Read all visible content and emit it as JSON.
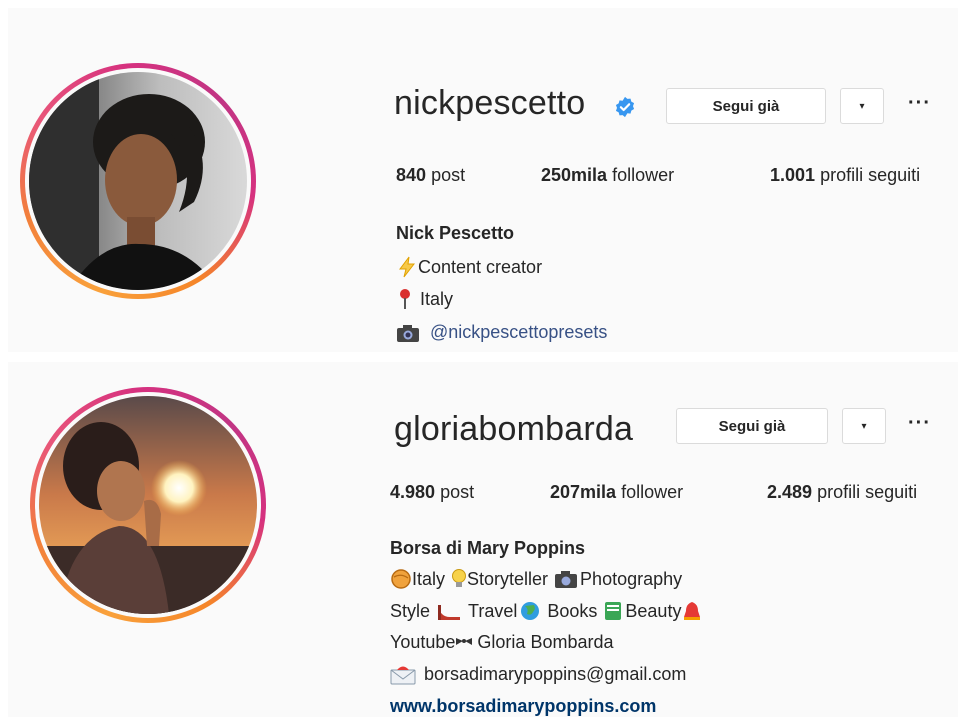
{
  "profiles": [
    {
      "username": "nickpescetto",
      "verified": true,
      "follow_button": "Segui già",
      "more": "···",
      "stats": {
        "posts_value": "840",
        "posts_label": "post",
        "followers_value": "250mila",
        "followers_label": "follower",
        "following_value": "1.001",
        "following_label": "profili seguiti"
      },
      "bio": {
        "name": "Nick Pescetto",
        "line1": "Content creator",
        "line2": "Italy",
        "line3": "@nickpescettopresets"
      }
    },
    {
      "username": "gloriabombarda",
      "verified": false,
      "follow_button": "Segui già",
      "more": "···",
      "stats": {
        "posts_value": "4.980",
        "posts_label": "post",
        "followers_value": "207mila",
        "followers_label": "follower",
        "following_value": "2.489",
        "following_label": "profili seguiti"
      },
      "bio": {
        "name": "Borsa di Mary Poppins",
        "l1_a": "Italy",
        "l1_b": "Storyteller",
        "l1_c": "Photography",
        "l2_a": "Style",
        "l2_b": "Travel",
        "l2_c": "Books",
        "l2_d": "Beauty",
        "l3_a": "Youtube",
        "l3_b": "Gloria Bombarda",
        "l4": "borsadimarypoppins@gmail.com",
        "website": "www.borsadimarypoppins.com"
      }
    }
  ],
  "icons": {
    "verified": "verified-badge-icon",
    "caret": "▾",
    "lightning": "lightning-icon",
    "pin": "pushpin-icon",
    "camera": "camera-icon",
    "globe": "globe-icon",
    "bulb": "lightbulb-icon",
    "heel": "high-heel-icon",
    "book": "book-icon",
    "bell": "bell-icon",
    "mail": "envelope-icon",
    "ribbon": "ribbon-icon"
  },
  "colors": {
    "verified_blue": "#3897f0",
    "link_blue": "#385185",
    "website_blue": "#003569",
    "ring_gradient_start": "#f58529",
    "ring_gradient_end": "#c13584"
  }
}
